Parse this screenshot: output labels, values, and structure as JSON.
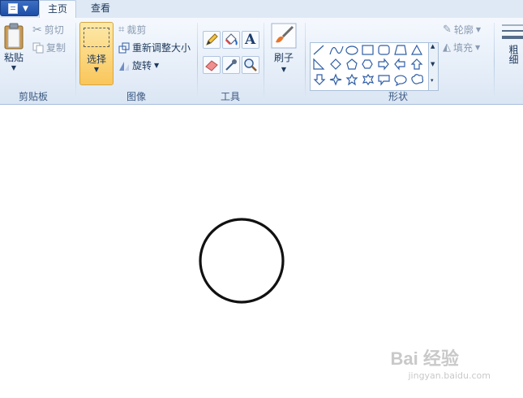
{
  "tabs": [
    "主页",
    "查看"
  ],
  "clipboard": {
    "paste": "粘贴",
    "cut": "剪切",
    "copy": "复制",
    "group": "剪贴板"
  },
  "image": {
    "select": "选择",
    "crop": "裁剪",
    "resize": "重新调整大小",
    "rotate": "旋转",
    "group": "图像"
  },
  "tools": {
    "group": "工具"
  },
  "brushes": {
    "label": "刷子"
  },
  "shapes": {
    "outline": "轮廓",
    "fill": "填充",
    "group": "形状",
    "items": [
      "line-icon",
      "curve-icon",
      "oval-icon",
      "rectangle-icon",
      "rounded-rectangle-icon",
      "polygon-icon",
      "triangle-icon",
      "right-triangle-icon",
      "diamond-icon",
      "pentagon-icon",
      "hexagon-icon",
      "right-arrow-icon",
      "left-arrow-icon",
      "up-arrow-icon",
      "down-arrow-icon",
      "four-point-star-icon",
      "five-point-star-icon",
      "six-point-star-icon",
      "rect-callout-icon",
      "oval-callout-icon",
      "cloud-callout-icon"
    ]
  },
  "size": {
    "label": "粗细"
  },
  "watermark": {
    "brand": "Bai 经验",
    "url": "jingyan.baidu.com"
  },
  "colors": {
    "ribbon": "#dbe6f4",
    "selected": "#fcd576",
    "text": "#1e395b"
  }
}
